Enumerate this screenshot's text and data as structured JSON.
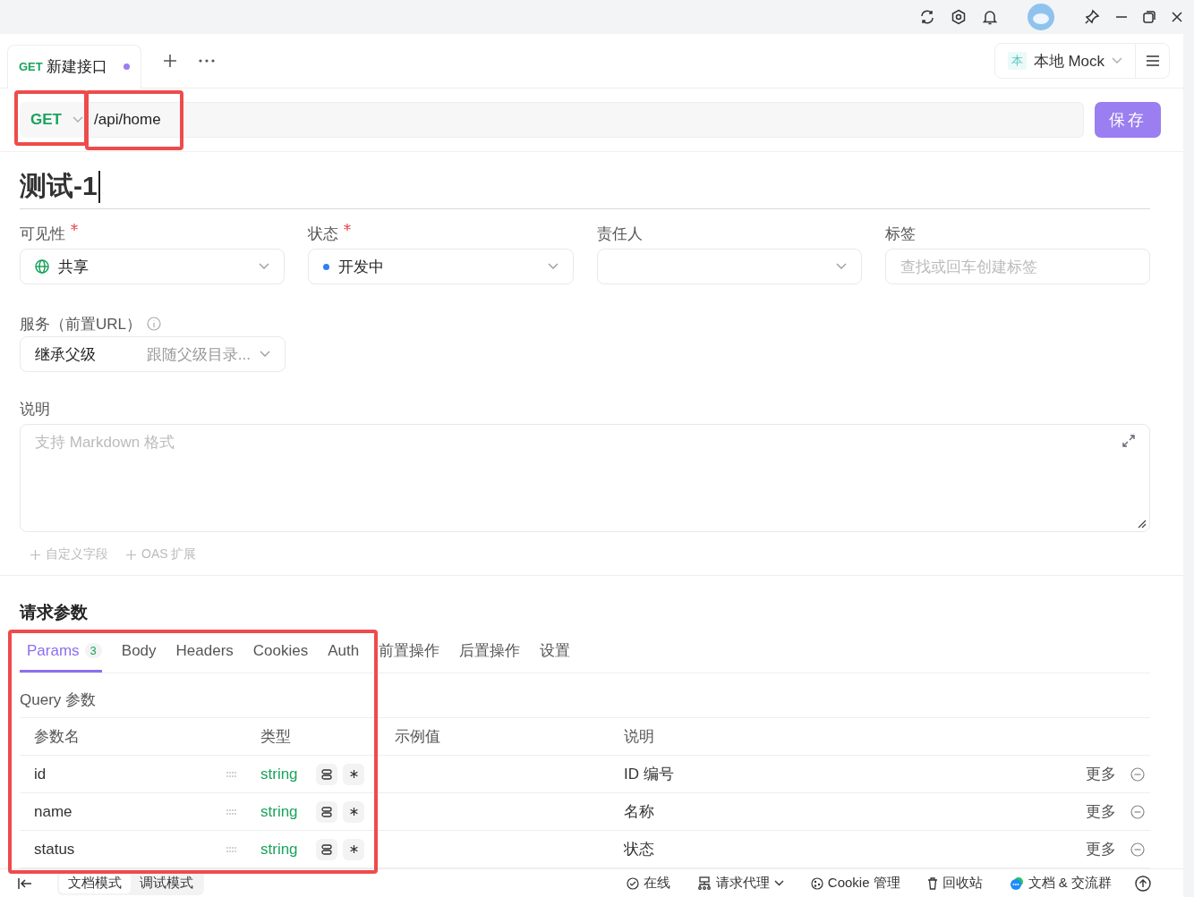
{
  "tabs": [
    {
      "method": "GET",
      "label": "新建接口",
      "unsaved": true
    }
  ],
  "environment": {
    "badge": "本",
    "label": "本地 Mock"
  },
  "request": {
    "method": {
      "value": "GET",
      "highlighted": true
    },
    "url": {
      "value": "/api/home",
      "highlighted": true
    },
    "save": "保存"
  },
  "title": "测试-1",
  "fields": [
    {
      "kind": "visibility",
      "label": "可见性",
      "required": true,
      "value": "共享"
    },
    {
      "kind": "status",
      "label": "状态",
      "required": true,
      "value": "开发中",
      "color": "#2f7ff5"
    },
    {
      "kind": "select",
      "label": "责任人",
      "required": false
    },
    {
      "kind": "tags",
      "label": "标签",
      "required": false,
      "placeholder": "查找或回车创建标签"
    }
  ],
  "service": {
    "label": "服务（前置URL）",
    "value": "继承父级",
    "hint": "跟随父级目录..."
  },
  "description": {
    "label": "说明",
    "placeholder": "支持 Markdown 格式"
  },
  "extras": [
    "自定义字段",
    "OAS 扩展"
  ],
  "params": {
    "title": "请求参数",
    "highlighted": true,
    "tabs": [
      {
        "label": "Params",
        "count": "3",
        "selected": true
      },
      {
        "label": "Body",
        "selected": false
      },
      {
        "label": "Headers",
        "selected": false
      },
      {
        "label": "Cookies",
        "selected": false
      },
      {
        "label": "Auth",
        "selected": false
      },
      {
        "label": "前置操作",
        "selected": false
      },
      {
        "label": "后置操作",
        "selected": false
      },
      {
        "label": "设置",
        "selected": false
      }
    ],
    "query_title": "Query 参数",
    "columns": [
      "参数名",
      "类型",
      "示例值",
      "说明"
    ],
    "rows": [
      {
        "name": "id",
        "type": "string",
        "description": "ID 编号",
        "more": "更多"
      },
      {
        "name": "name",
        "type": "string",
        "description": "名称",
        "more": "更多"
      },
      {
        "name": "status",
        "type": "string",
        "description": "状态",
        "more": "更多"
      }
    ]
  },
  "status_bar": {
    "modes": [
      {
        "label": "文档模式",
        "selected": true
      },
      {
        "label": "调试模式",
        "selected": false
      }
    ],
    "items": [
      {
        "kind": "online",
        "label": "在线"
      },
      {
        "kind": "proxy",
        "label": "请求代理"
      },
      {
        "kind": "cookie",
        "label": "Cookie 管理"
      },
      {
        "kind": "trash",
        "label": "回收站"
      },
      {
        "kind": "chat",
        "label": "文档 & 交流群"
      }
    ]
  }
}
